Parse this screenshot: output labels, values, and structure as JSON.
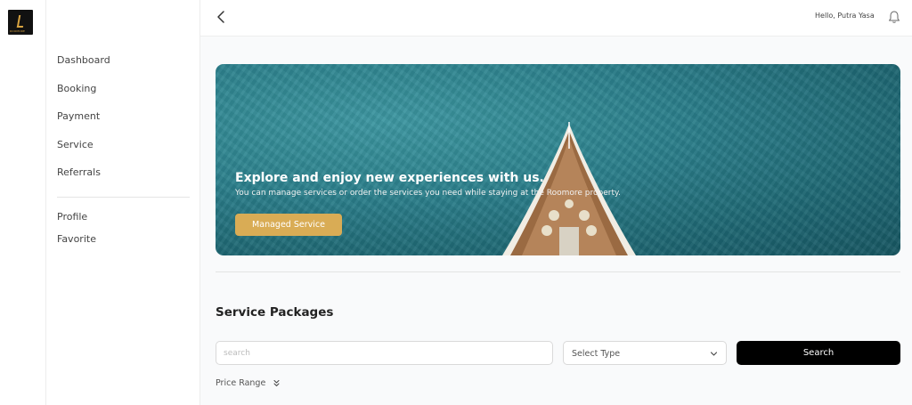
{
  "brand": {
    "logo_text": "ROOMORE"
  },
  "sidebar": {
    "items": [
      {
        "label": "Dashboard"
      },
      {
        "label": "Booking"
      },
      {
        "label": "Payment"
      },
      {
        "label": "Service"
      },
      {
        "label": "Referrals"
      }
    ],
    "secondary": [
      {
        "label": "Profile"
      },
      {
        "label": "Favorite"
      }
    ]
  },
  "header": {
    "greeting": "Hello, Putra Yasa",
    "back_icon": "chevron-left-icon",
    "notification_icon": "bell-icon"
  },
  "hero": {
    "title": "Explore and enjoy new experiences with us.",
    "subtitle": "You can manage services or order the services you need while staying at the Roomore property.",
    "button_label": "Managed Service",
    "button_color": "#d9ac55"
  },
  "packages": {
    "title": "Service Packages",
    "search_placeholder": "search",
    "search_value": "",
    "type_select_value": "Select Type",
    "search_button": "Search",
    "price_range_label": "Price Range"
  }
}
